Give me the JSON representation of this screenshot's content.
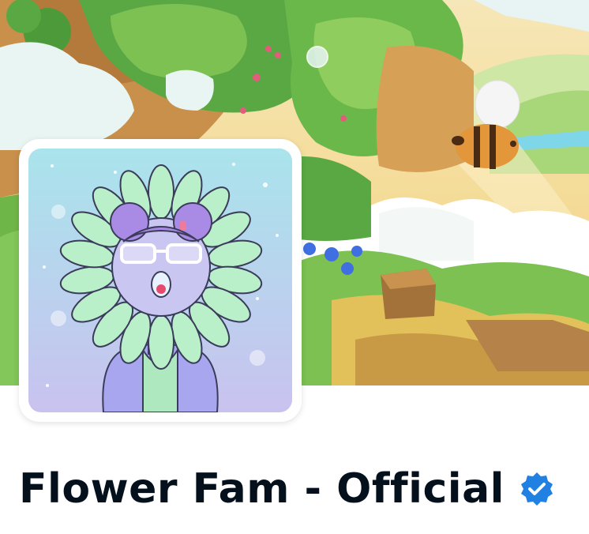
{
  "profile": {
    "name": "Flower Fam - Official",
    "verified": true,
    "verified_icon": "verified-badge-icon",
    "verified_color": "#2081e2"
  },
  "banner": {
    "icon": "collection-banner-image"
  },
  "avatar": {
    "icon": "flower-character-avatar"
  },
  "colors": {
    "name_text": "#04111d",
    "page_background": "#ffffff"
  }
}
